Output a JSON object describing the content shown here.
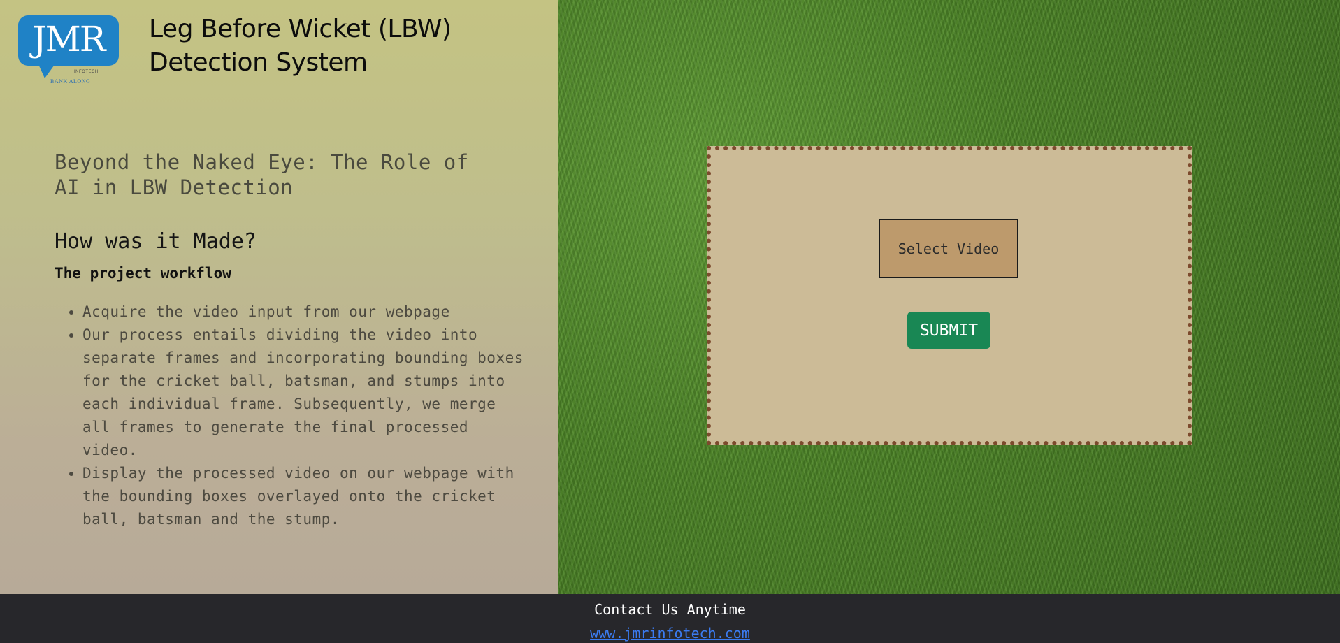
{
  "logo": {
    "brand": "JMR",
    "sub1": "INFOTECH",
    "sub2": "BANK ALONG",
    "color": "#1f82c6"
  },
  "header": {
    "title": "Leg Before Wicket (LBW) Detection System"
  },
  "info": {
    "subtitle": "Beyond the Naked Eye: The Role of AI in LBW Detection",
    "how_made": "How was it Made?",
    "workflow_label": "The project workflow",
    "steps": [
      "Acquire the video input from our webpage",
      "Our process entails dividing the video into separate frames and incorporating bounding boxes for the cricket ball, batsman, and stumps into each individual frame. Subsequently, we merge all frames to generate the final processed video.",
      "Display the processed video on our webpage with the bounding boxes overlayed onto the cricket ball, batsman and the stump."
    ]
  },
  "upload": {
    "select_label": "Select Video",
    "submit_label": "SUBMIT",
    "submit_color": "#198754",
    "panel_color": "#ccbb97",
    "border_color": "#7c4a2d"
  },
  "footer": {
    "contact": "Contact Us Anytime",
    "link": "www.jmrinfotech.com"
  }
}
